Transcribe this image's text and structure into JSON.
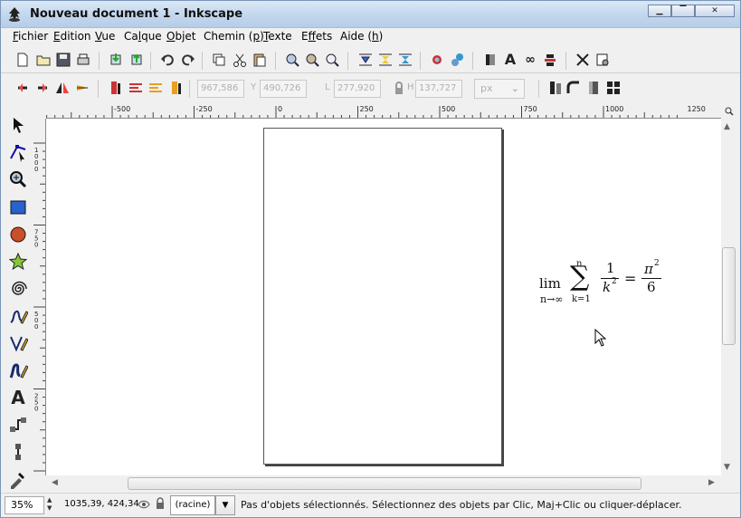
{
  "window": {
    "title": "Nouveau document 1 - Inkscape",
    "buttons": {
      "minimize": "▁",
      "maximize": "▔",
      "close": "✕"
    }
  },
  "menubar": [
    {
      "pre": "",
      "ul": "F",
      "post": "ichier"
    },
    {
      "pre": "",
      "ul": "E",
      "post": "dition"
    },
    {
      "pre": "",
      "ul": "V",
      "post": "ue"
    },
    {
      "pre": "Ca",
      "ul": "l",
      "post": "que"
    },
    {
      "pre": "",
      "ul": "O",
      "post": "bjet"
    },
    {
      "pre": "Chemin (",
      "ul": "p",
      "post": ")"
    },
    {
      "pre": "",
      "ul": "T",
      "post": "exte"
    },
    {
      "pre": "E",
      "ul": "f",
      "post": "fets"
    },
    {
      "pre": "Aide (",
      "ul": "h",
      "post": ")"
    }
  ],
  "selector_toolbar": {
    "x_value": "967,586",
    "y_value": "490,726",
    "w_value": "277,920",
    "h_value": "137,727",
    "x_label": "X",
    "y_label": "Y",
    "w_label": "L",
    "h_label": "H",
    "unit": "px"
  },
  "ruler": {
    "h_ticks": [
      "-500",
      "-250",
      "0",
      "250",
      "500",
      "750",
      "1000",
      "1250"
    ],
    "v_ticks": [
      "1000",
      "750",
      "500",
      "250",
      "0"
    ]
  },
  "canvas": {
    "formula": {
      "lim": "lim",
      "lim_sub": "n→∞",
      "sum": "∑",
      "sum_top": "n",
      "sum_bottom": "k=1",
      "frac1_num": "1",
      "frac1_den": "k",
      "frac1_den_exp": "2",
      "equals": "=",
      "frac2_num": "π",
      "frac2_num_exp": "2",
      "frac2_den": "6"
    }
  },
  "statusbar": {
    "zoom": "35%",
    "coords": "1035,39, 424,34",
    "layer": "(racine)",
    "message": "Pas d'objets sélectionnés. Sélectionnez des objets par Clic, Maj+Clic ou cliquer-déplacer."
  }
}
